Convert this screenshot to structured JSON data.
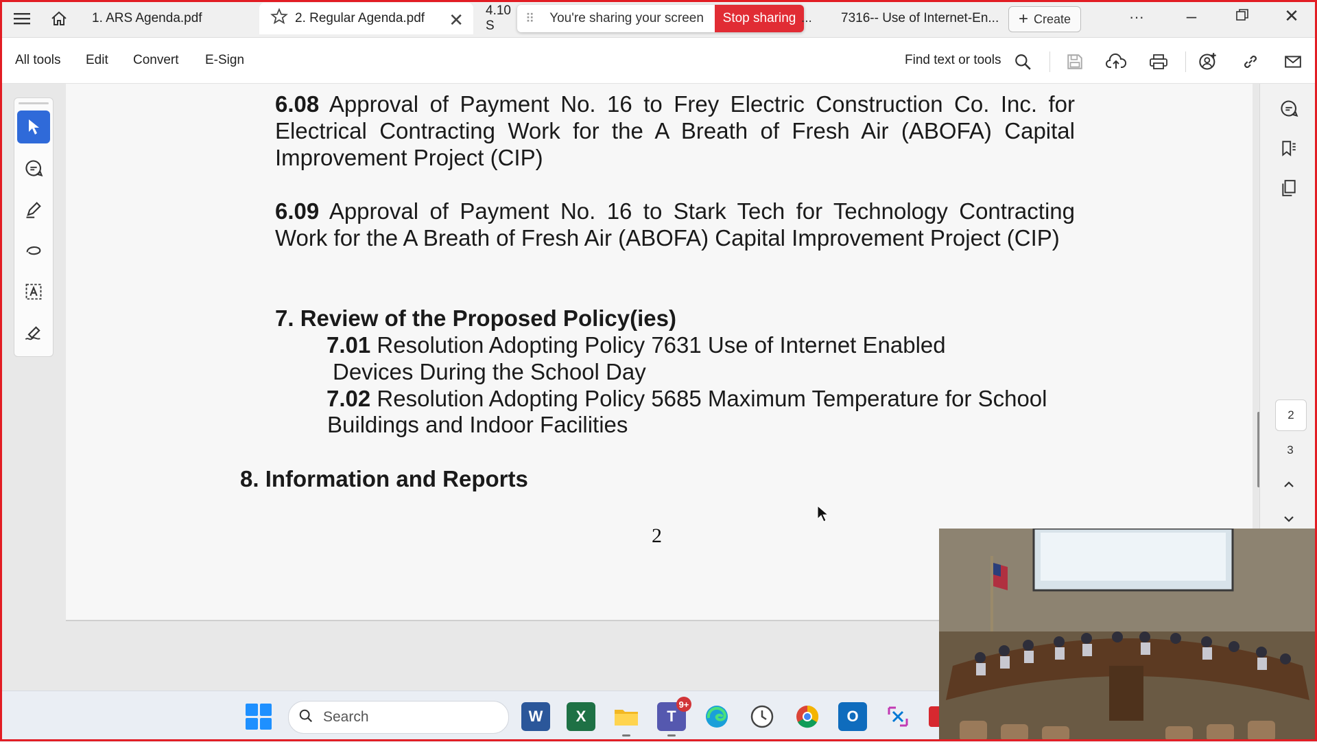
{
  "tabs": [
    {
      "label": "1. ARS Agenda.pdf"
    },
    {
      "label": "2. Regular Agenda.pdf"
    },
    {
      "label": "4.10 S"
    },
    {
      "label": "7316-- Use of Internet-En..."
    }
  ],
  "share_bar": {
    "text": "You're sharing your screen",
    "stop_label": "Stop sharing",
    "more": "..."
  },
  "create_label": "Create",
  "more_label": "···",
  "menu": {
    "all_tools": "All tools",
    "edit": "Edit",
    "convert": "Convert",
    "esign": "E-Sign",
    "find": "Find text or tools"
  },
  "doc": {
    "item_608_num": "6.08",
    "item_608_text": "Approval of Payment No. 16 to Frey Electric Construction Co. Inc. for Electrical Contracting Work for the A Breath of Fresh Air (ABOFA) Capital Improvement Project (CIP)",
    "item_609_num": "6.09",
    "item_609_text": "Approval of Payment No. 16 to Stark Tech for Technology Contracting Work for the A Breath of Fresh Air (ABOFA) Capital Improvement Project (CIP)",
    "section7": "7. Review of the Proposed Policy(ies)",
    "item_701_num": "7.01",
    "item_701_line1": "Resolution Adopting  Policy 7631 Use of Internet Enabled",
    "item_701_line2": "Devices During the School Day",
    "item_702_num": "7.02",
    "item_702_line1": "Resolution Adopting Policy 5685 Maximum Temperature for School",
    "item_702_line2": "Buildings and Indoor Facilities",
    "section8": "8. Information and Reports",
    "page_number": "2"
  },
  "pages": {
    "current": "2",
    "next": "3"
  },
  "taskbar": {
    "search_placeholder": "Search",
    "teams_badge": "9+"
  },
  "colors": {
    "share_red": "#e12c34",
    "frame_red": "#e21d24",
    "accent_blue": "#2f6ad9"
  }
}
